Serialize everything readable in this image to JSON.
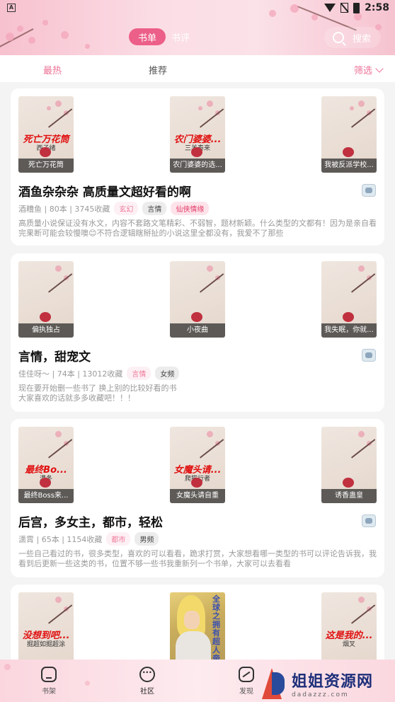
{
  "statusbar": {
    "time": "2:58",
    "notif_letter": "A"
  },
  "header": {
    "tab_active": "书单",
    "tab_inactive": "书评",
    "search_label": "搜索"
  },
  "filters": {
    "hot": "最热",
    "recommend": "推荐",
    "filter": "筛选"
  },
  "cards": [
    {
      "covers": [
        {
          "title": "死亡万花筒",
          "author": "西子绪",
          "caption": "死亡万花筒"
        },
        {
          "title": "农门婆婆...",
          "author": "三羊泰来",
          "caption": "农门婆婆的选..."
        },
        {
          "title": "",
          "author": "",
          "caption": "我被反派学校..."
        }
      ],
      "title": "酒鱼杂杂杂 高质量文超好看的啊",
      "meta": "酒糟鱼 | 80本 | 3745收藏",
      "tags": [
        "玄幻",
        "言情",
        "仙侠情缘"
      ],
      "desc": "高质量小说保证没有水文，内容不套路文笔精彩、不弱智，题材新颖。什么类型的文都有！因为是亲自看完果断可能会较慢噢😊不符合逻辑瞎掰扯的小说这里全都没有，我爱不了那些"
    },
    {
      "covers": [
        {
          "title": "",
          "author": "",
          "caption": "偏执独占"
        },
        {
          "title": "",
          "author": "",
          "caption": "小夜曲"
        },
        {
          "title": "",
          "author": "",
          "caption": "我失眠，你就..."
        }
      ],
      "title": "言情，甜宠文",
      "meta": "佳佳呀～ | 74本 | 13012收藏",
      "tags": [
        "言情",
        "女频"
      ],
      "desc": "现在要开始删一些书了 换上别的比较好看的书\n大家喜欢的话就多多收藏吧！！！"
    },
    {
      "covers": [
        {
          "title": "最终Bo...",
          "author": "漠冬",
          "caption": "最终Boss来..."
        },
        {
          "title": "女魔头请...",
          "author": "爬猫行者",
          "caption": "女魔头请自重"
        },
        {
          "title": "",
          "author": "",
          "caption": "诱香蛊皇"
        }
      ],
      "title": "后宫，多女主，都市，轻松",
      "meta": "潇霄 | 65本 | 1154收藏",
      "tags": [
        "都市",
        "男频"
      ],
      "desc": "一些自己看过的书，很多类型，喜欢的可以看看，跪求打赏，大家想看哪一类型的书可以评论告诉我，我看到后更新一些这类的书，位置不够一些书我重新列一个书单，大家可以去看看"
    },
    {
      "covers": [
        {
          "title": "没想到吧...",
          "author": "掘超如掘超涂",
          "caption": ""
        },
        {
          "title": "全球之拥有超人帝国",
          "author": "",
          "caption": ""
        },
        {
          "title": "这是我的...",
          "author": "烟叉",
          "caption": ""
        }
      ]
    }
  ],
  "bottomnav": {
    "shelf": "书架",
    "community": "社区",
    "discover": "发现"
  },
  "watermark": {
    "name": "姐姐资源网",
    "domain": "dadazzz.com"
  }
}
